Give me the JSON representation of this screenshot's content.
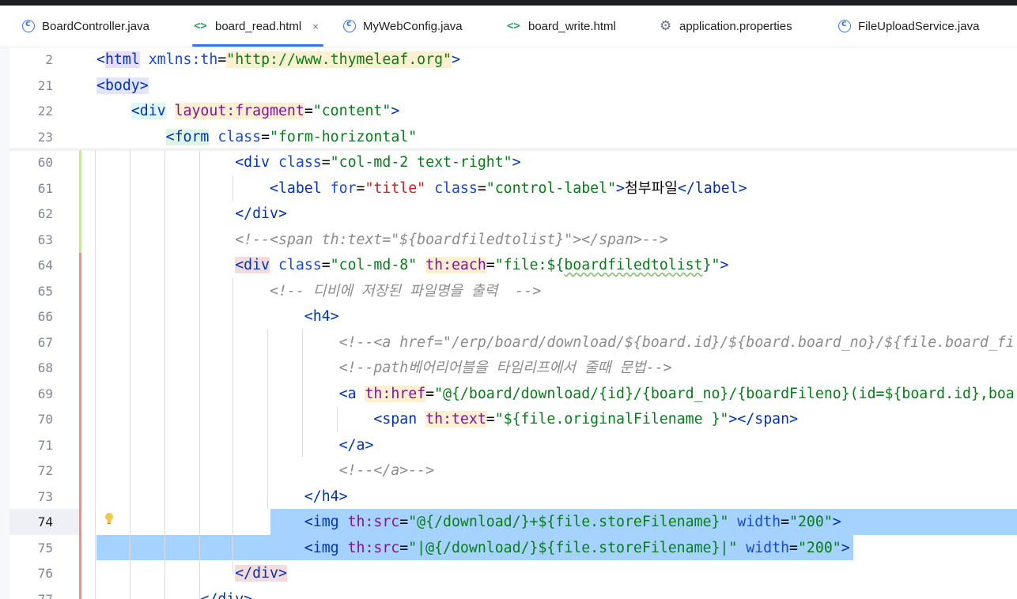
{
  "tabs": [
    {
      "label": "BoardController.java",
      "icon": "class-icon",
      "active": false
    },
    {
      "label": "board_read.html",
      "icon": "html-icon",
      "active": true
    },
    {
      "label": "MyWebConfig.java",
      "icon": "class-icon",
      "active": false
    },
    {
      "label": "board_write.html",
      "icon": "html-icon",
      "active": false
    },
    {
      "label": "application.properties",
      "icon": "settings-icon",
      "active": false
    },
    {
      "label": "FileUploadService.java",
      "icon": "class-icon",
      "active": false
    }
  ],
  "tab_close_glyph": "×",
  "colors": {
    "accent": "#3574f0",
    "selection": "#a6d2ff",
    "tag": "#0033b3",
    "string": "#067d17",
    "comment": "#8c8c8c",
    "th_attr": "#871094"
  },
  "lines": [
    {
      "n": "2",
      "t": [
        [
          "<",
          "tg"
        ],
        [
          "html",
          "tg hl-tag"
        ],
        [
          " ",
          ""
        ],
        [
          "xmlns:th",
          "at"
        ],
        [
          "=",
          ""
        ],
        [
          "\"http://www.thymeleaf.org\"",
          "av hl-th"
        ],
        [
          ">",
          "tg"
        ]
      ]
    },
    {
      "n": "21",
      "t": [
        [
          "<",
          "tg hl-body"
        ],
        [
          "body",
          "tg hl-body"
        ],
        [
          ">",
          "tg hl-body"
        ]
      ]
    },
    {
      "n": "22",
      "t": [
        [
          "    ",
          ""
        ],
        [
          "<",
          "tg hl-cyan"
        ],
        [
          "div",
          "tg hl-cyan"
        ],
        [
          " ",
          ""
        ],
        [
          "layout:fragment",
          "th hl-th"
        ],
        [
          "=",
          ""
        ],
        [
          "\"content\"",
          "av"
        ],
        [
          ">",
          "tg"
        ]
      ]
    },
    {
      "n": "23",
      "t": [
        [
          "        ",
          ""
        ],
        [
          "<",
          "tg hl-green"
        ],
        [
          "form",
          "tg hl-green"
        ],
        [
          " ",
          ""
        ],
        [
          "class",
          "at"
        ],
        [
          "=",
          ""
        ],
        [
          "\"form-horizontal\"",
          "av"
        ]
      ]
    },
    {
      "n": "60",
      "t": [
        [
          "                ",
          ""
        ],
        [
          "<",
          "tg"
        ],
        [
          "div",
          "tg"
        ],
        [
          " ",
          ""
        ],
        [
          "class",
          "at"
        ],
        [
          "=",
          ""
        ],
        [
          "\"col-md-2 text-right\"",
          "av"
        ],
        [
          ">",
          "tg"
        ]
      ]
    },
    {
      "n": "61",
      "t": [
        [
          "                    ",
          ""
        ],
        [
          "<",
          "tg"
        ],
        [
          "label",
          "tg"
        ],
        [
          " ",
          ""
        ],
        [
          "for",
          "at"
        ],
        [
          "=",
          ""
        ],
        [
          "\"title\"",
          "av-red"
        ],
        [
          " ",
          ""
        ],
        [
          "class",
          "at"
        ],
        [
          "=",
          ""
        ],
        [
          "\"control-label\"",
          "av"
        ],
        [
          ">",
          "tg"
        ],
        [
          "첨부파일",
          ""
        ],
        [
          "</",
          "tg"
        ],
        [
          "label",
          "tg"
        ],
        [
          ">",
          "tg"
        ]
      ]
    },
    {
      "n": "62",
      "t": [
        [
          "                ",
          ""
        ],
        [
          "</",
          "tg"
        ],
        [
          "div",
          "tg"
        ],
        [
          ">",
          "tg"
        ]
      ]
    },
    {
      "n": "63",
      "t": [
        [
          "                ",
          ""
        ],
        [
          "<!--<span th:text=\"${boardfiledtolist}\"></span>-->",
          "cm"
        ]
      ]
    },
    {
      "n": "64",
      "t": [
        [
          "                ",
          ""
        ],
        [
          "<",
          "tg hl-div"
        ],
        [
          "div",
          "tg hl-div"
        ],
        [
          " ",
          ""
        ],
        [
          "class",
          "at"
        ],
        [
          "=",
          ""
        ],
        [
          "\"col-md-8\"",
          "av"
        ],
        [
          " ",
          ""
        ],
        [
          "th:each",
          "th hl-th"
        ],
        [
          "=",
          ""
        ],
        [
          "\"file:${",
          "av"
        ],
        [
          "boardfiledtolist",
          "av wavy"
        ],
        [
          "}\"",
          "av"
        ],
        [
          ">",
          "tg"
        ]
      ]
    },
    {
      "n": "65",
      "t": [
        [
          "                    ",
          ""
        ],
        [
          "<!-- 디비에 저장된 파일명을 출력  -->",
          "cm"
        ]
      ]
    },
    {
      "n": "66",
      "t": [
        [
          "                        ",
          ""
        ],
        [
          "<",
          "tg"
        ],
        [
          "h4",
          "tg"
        ],
        [
          ">",
          "tg"
        ]
      ]
    },
    {
      "n": "67",
      "t": [
        [
          "                            ",
          ""
        ],
        [
          "<!--<a href=\"/erp/board/download/${board.id}/${board.board_no}/${file.board_fi",
          "cm"
        ]
      ]
    },
    {
      "n": "68",
      "t": [
        [
          "                            ",
          ""
        ],
        [
          "<!--path베어리어블을 타임리프에서 줄때 문법-->",
          "cm"
        ]
      ]
    },
    {
      "n": "69",
      "t": [
        [
          "                            ",
          ""
        ],
        [
          "<",
          "tg"
        ],
        [
          "a",
          "tg"
        ],
        [
          " ",
          ""
        ],
        [
          "th:href",
          "th hl-th"
        ],
        [
          "=",
          ""
        ],
        [
          "\"@{/board/download/{id}/{board_no}/{boardFileno}(id=${board.id},boa",
          "av"
        ]
      ]
    },
    {
      "n": "70",
      "t": [
        [
          "                                ",
          ""
        ],
        [
          "<",
          "tg"
        ],
        [
          "span",
          "tg"
        ],
        [
          " ",
          ""
        ],
        [
          "th:text",
          "th hl-th"
        ],
        [
          "=",
          ""
        ],
        [
          "\"${file.originalFilename }\"",
          "av"
        ],
        [
          ">",
          "tg"
        ],
        [
          "</",
          "tg"
        ],
        [
          "span",
          "tg"
        ],
        [
          ">",
          "tg"
        ]
      ]
    },
    {
      "n": "71",
      "t": [
        [
          "                            ",
          ""
        ],
        [
          "</",
          "tg"
        ],
        [
          "a",
          "tg"
        ],
        [
          ">",
          "tg"
        ]
      ]
    },
    {
      "n": "72",
      "t": [
        [
          "                            ",
          ""
        ],
        [
          "<!--</a>-->",
          "cm"
        ]
      ]
    },
    {
      "n": "73",
      "t": [
        [
          "                        ",
          ""
        ],
        [
          "</",
          "tg"
        ],
        [
          "h4",
          "tg"
        ],
        [
          ">",
          "tg"
        ]
      ]
    },
    {
      "n": "74",
      "t": [
        [
          "                        ",
          ""
        ],
        [
          "<",
          "tg"
        ],
        [
          "img",
          "tg"
        ],
        [
          " ",
          ""
        ],
        [
          "th:src",
          "th"
        ],
        [
          "=",
          ""
        ],
        [
          "\"@{/download/}+${file.storeFilename}\"",
          "av"
        ],
        [
          " ",
          ""
        ],
        [
          "width",
          "at"
        ],
        [
          "=",
          ""
        ],
        [
          "\"200\"",
          "av"
        ],
        [
          ">",
          "tg"
        ]
      ]
    },
    {
      "n": "75",
      "t": [
        [
          "                        ",
          ""
        ],
        [
          "<",
          "tg"
        ],
        [
          "img",
          "tg"
        ],
        [
          " ",
          ""
        ],
        [
          "th:src",
          "th"
        ],
        [
          "=",
          ""
        ],
        [
          "\"|@{/download/}${file.storeFilename}|\"",
          "av"
        ],
        [
          " ",
          ""
        ],
        [
          "width",
          "at"
        ],
        [
          "=",
          ""
        ],
        [
          "\"200\"",
          "av"
        ],
        [
          ">",
          "tg"
        ]
      ]
    },
    {
      "n": "76",
      "t": [
        [
          "                ",
          ""
        ],
        [
          "</",
          "tg hl-div"
        ],
        [
          "div",
          "tg hl-div"
        ],
        [
          ">",
          "tg hl-div"
        ]
      ]
    },
    {
      "n": "77",
      "t": [
        [
          "            ",
          ""
        ],
        [
          "</",
          "tg"
        ],
        [
          "div",
          "tg"
        ],
        [
          ">",
          "tg"
        ]
      ]
    }
  ]
}
